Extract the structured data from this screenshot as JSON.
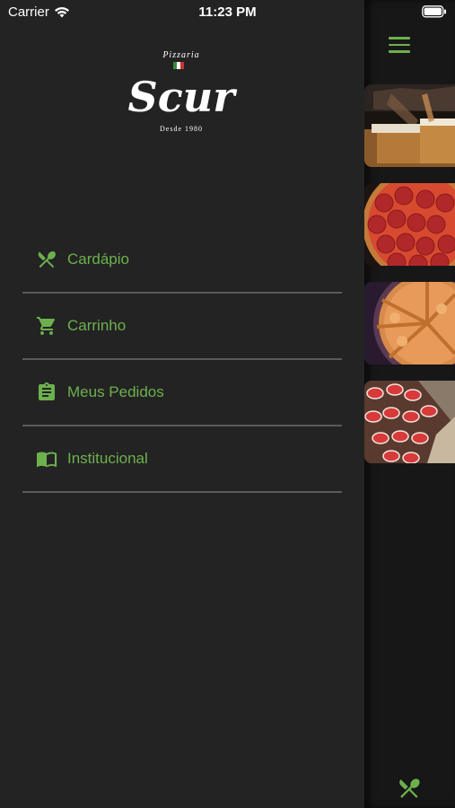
{
  "status": {
    "carrier": "Carrier",
    "time": "11:23 PM"
  },
  "logo": {
    "top_text": "Pizzaria",
    "brand": "Scur",
    "bottom_text": "Desde 1980"
  },
  "menu": {
    "items": [
      {
        "label": "Cardápio",
        "icon": "fork-knife-icon"
      },
      {
        "label": "Carrinho",
        "icon": "cart-icon"
      },
      {
        "label": "Meus Pedidos",
        "icon": "clipboard-icon"
      },
      {
        "label": "Institucional",
        "icon": "book-icon"
      }
    ]
  },
  "colors": {
    "accent": "#6db04e",
    "drawer_bg": "#232323",
    "divider": "#5a5a5a"
  },
  "content": {
    "thumbnails": [
      "beer-photo",
      "pepperoni-pizza-photo",
      "caramel-pizza-photo",
      "strawberry-chocolate-pizza-photo"
    ],
    "bottom_icon": "fork-knife-icon"
  }
}
